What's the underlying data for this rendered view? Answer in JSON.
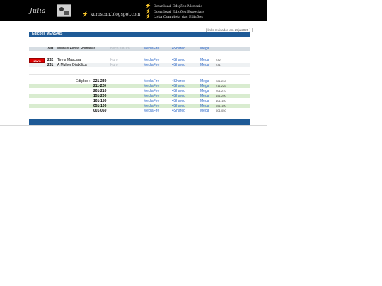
{
  "header": {
    "logo_text": "Julia",
    "site": "kuroscan.blogspot.com",
    "links": [
      "Download Edições Mensais",
      "Download Edições Especiais",
      "Lista Completa das Edições"
    ]
  },
  "updated": "[ links revisados em 25jul2025 ]",
  "section_title": "Edições MENSAIS",
  "badge_new": "NOVO",
  "featured": [
    {
      "num": "300",
      "title": "Minhas Férias Romanas",
      "note": "Beco e Kuro",
      "mediafire": "MediaFire",
      "shared": "4Shared",
      "mega": "Mega",
      "range": ""
    }
  ],
  "recent": [
    {
      "num": "232",
      "title": "Tire a Máscara",
      "note": "Kuro",
      "mediafire": "MediaFire",
      "shared": "4Shared",
      "mega": "Mega",
      "range": "232"
    },
    {
      "num": "231",
      "title": "A Mulher Diabólica",
      "note": "Kuro",
      "mediafire": "MediaFire",
      "shared": "4Shared",
      "mega": "Mega",
      "range": "231"
    }
  ],
  "editions_label": "Edições :",
  "editions": [
    {
      "range": "221-230",
      "mediafire": "MediaFire",
      "shared": "4Shared",
      "mega": "Mega",
      "small": "221-230"
    },
    {
      "range": "211-220",
      "mediafire": "MediaFire",
      "shared": "4Shared",
      "mega": "Mega",
      "small": "211-220"
    },
    {
      "range": "201-210",
      "mediafire": "MediaFire",
      "shared": "4Shared",
      "mega": "Mega",
      "small": "201-210"
    },
    {
      "range": "151-200",
      "mediafire": "MediaFire",
      "shared": "4Shared",
      "mega": "Mega",
      "small": "151-200"
    },
    {
      "range": "101-150",
      "mediafire": "MediaFire",
      "shared": "4Shared",
      "mega": "Mega",
      "small": "101-150"
    },
    {
      "range": "051-100",
      "mediafire": "MediaFire",
      "shared": "4Shared",
      "mega": "Mega",
      "small": "051-100"
    },
    {
      "range": "001-050",
      "mediafire": "MediaFire",
      "shared": "4Shared",
      "mega": "Mega",
      "small": "001-050"
    }
  ],
  "colors": {
    "header_bg": "#000000",
    "bar_blue": "#1e5a96",
    "row_gray": "#d6dde3",
    "row_green": "#d9ecd0",
    "link": "#2a66c8",
    "badge_red": "#e00000"
  }
}
